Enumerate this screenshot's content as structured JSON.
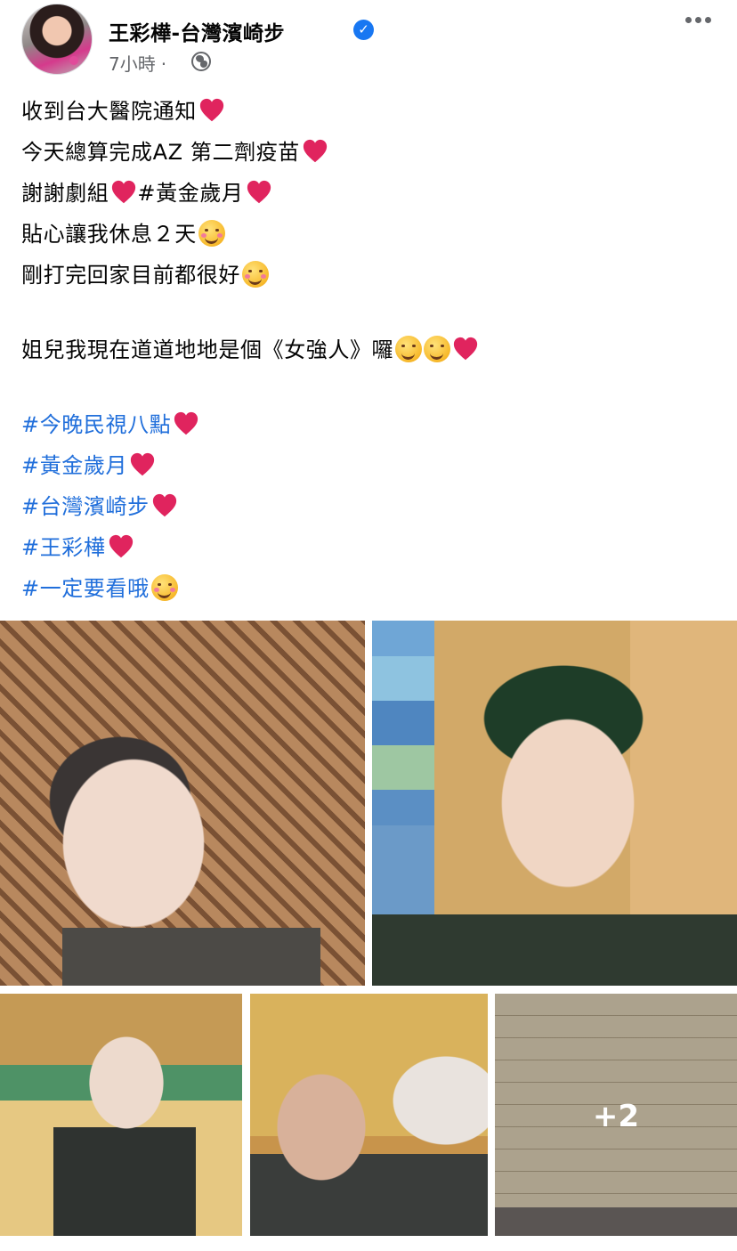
{
  "post": {
    "page_name": "王彩樺-台灣濱崎步",
    "time": "7小時",
    "separator": "·",
    "more_icon": "more-horizontal-icon",
    "privacy_icon": "globe-icon"
  },
  "text_lines": [
    {
      "text": "收到台大醫院通知",
      "emoji": "red-heart"
    },
    {
      "text": "今天總算完成AZ 第二劑疫苗",
      "emoji": "red-heart"
    },
    {
      "text": "謝謝劇組",
      "emoji": "red-heart",
      "hashtag": "#黃金歲月",
      "emoji2": "red-heart"
    },
    {
      "text": "貼心讓我休息２天",
      "emoji": "smiling-face-with-hearts"
    },
    {
      "text": "剛打完回家目前都很好",
      "emoji": "smiling-face"
    },
    {
      "text": "姐兒我現在道道地地是個《女強人》囉",
      "emojis": [
        "rolling-on-floor-laughing",
        "partying-face",
        "red-heart"
      ]
    }
  ],
  "hashtags": [
    {
      "tag": "#今晚民視八點",
      "emoji": "red-heart"
    },
    {
      "tag": "#黃金歲月",
      "emoji": "red-heart"
    },
    {
      "tag": "#台灣濱崎步",
      "emoji": "red-heart"
    },
    {
      "tag": "#王彩樺",
      "emoji": "red-heart"
    },
    {
      "tag": "#一定要看哦",
      "emoji": "face-blowing-kiss"
    }
  ],
  "photos": {
    "more_count": "+2"
  },
  "colors": {
    "hashtag": "#216fdb",
    "verified": "#1877f2",
    "meta": "#65676b",
    "heart": "#e0245e"
  }
}
